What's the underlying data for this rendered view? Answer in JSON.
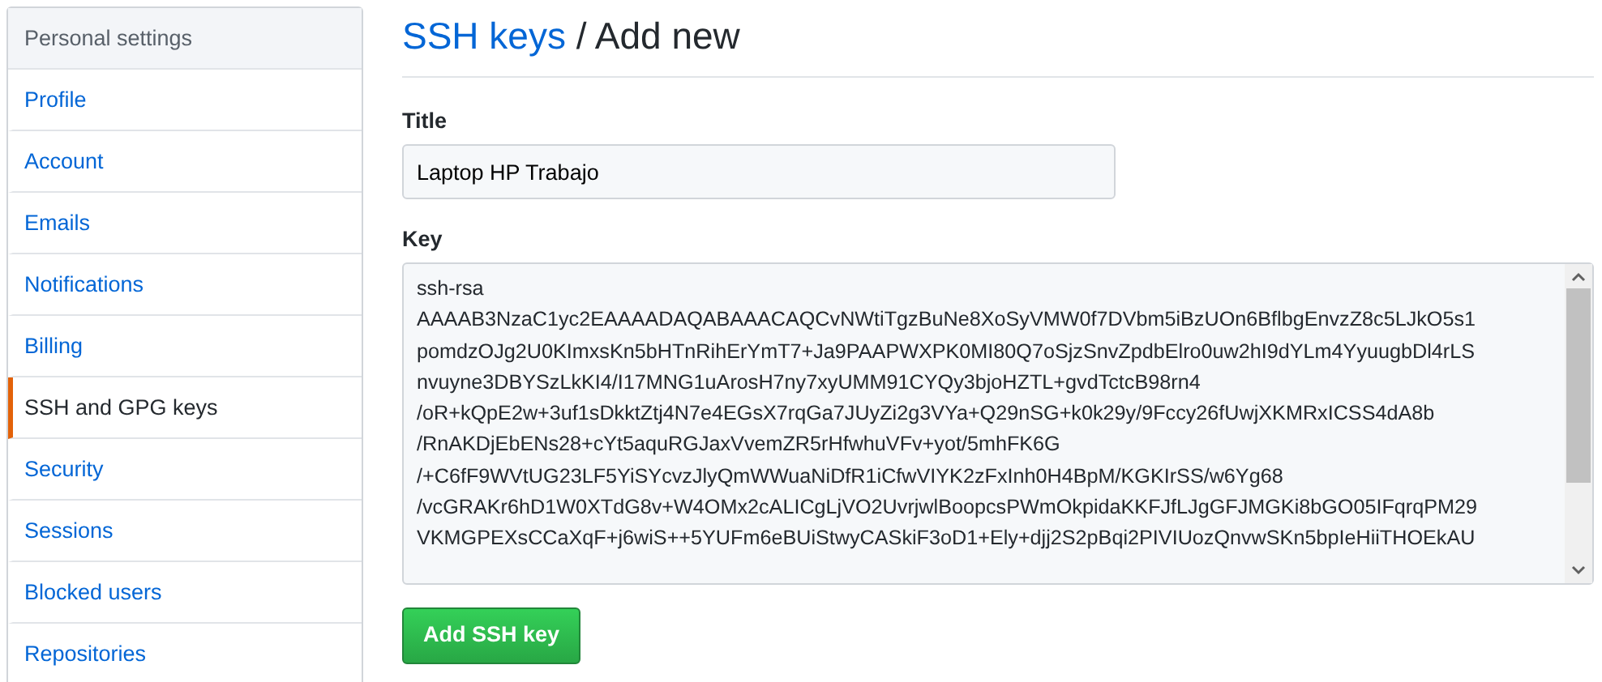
{
  "sidebar": {
    "heading": "Personal settings",
    "items": [
      {
        "label": "Profile",
        "selected": false
      },
      {
        "label": "Account",
        "selected": false
      },
      {
        "label": "Emails",
        "selected": false
      },
      {
        "label": "Notifications",
        "selected": false
      },
      {
        "label": "Billing",
        "selected": false
      },
      {
        "label": "SSH and GPG keys",
        "selected": true
      },
      {
        "label": "Security",
        "selected": false
      },
      {
        "label": "Sessions",
        "selected": false
      },
      {
        "label": "Blocked users",
        "selected": false
      },
      {
        "label": "Repositories",
        "selected": false
      }
    ]
  },
  "page_title": {
    "link": "SSH keys",
    "separator": "/",
    "text": "Add new"
  },
  "form": {
    "fields": [
      {
        "kind": "input",
        "label": "Title",
        "value": "Laptop HP Trabajo"
      },
      {
        "kind": "textarea",
        "label": "Key",
        "lines": [
          "ssh-rsa",
          "AAAAB3NzaC1yc2EAAAADAQABAAACAQCvNWtiTgzBuNe8XoSyVMW0f7DVbm5iBzUOn6BflbgEnvzZ8c5LJkO5s1",
          "pomdzOJg2U0KImxsKn5bHTnRihErYmT7+Ja9PAAPWXPK0MI80Q7oSjzSnvZpdbElro0uw2hI9dYLm4YyuugbDl4rLS",
          "nvuyne3DBYSzLkKI4/I17MNG1uArosH7ny7xyUMM91CYQy3bjoHZTL+gvdTctcB98rn4",
          "/oR+kQpE2w+3uf1sDkktZtj4N7e4EGsX7rqGa7JUyZi2g3VYa+Q29nSG+k0k29y/9Fccy26fUwjXKMRxICSS4dA8b",
          "/RnAKDjEbENs28+cYt5aquRGJaxVvemZR5rHfwhuVFv+yot/5mhFK6G",
          "/+C6fF9WVtUG23LF5YiSYcvzJlyQmWWuaNiDfR1iCfwVIYK2zFxInh0H4BpM/KGKIrSS/w6Yg68",
          "/vcGRAKr6hD1W0XTdG8v+W4OMx2cALICgLjVO2UvrjwlBoopcsPWmOkpidaKKFJfLJgGFJMGKi8bGO05IFqrqPM29",
          "VKMGPEXsCCaXqF+j6wiS++5YUFm6eBUiStwyCASkiF3oD1+Ely+djj2S2pBqi2PIVIUozQnvwSKn5bpIeHiiTHOEkAU"
        ]
      }
    ],
    "submit": "Add SSH key"
  }
}
